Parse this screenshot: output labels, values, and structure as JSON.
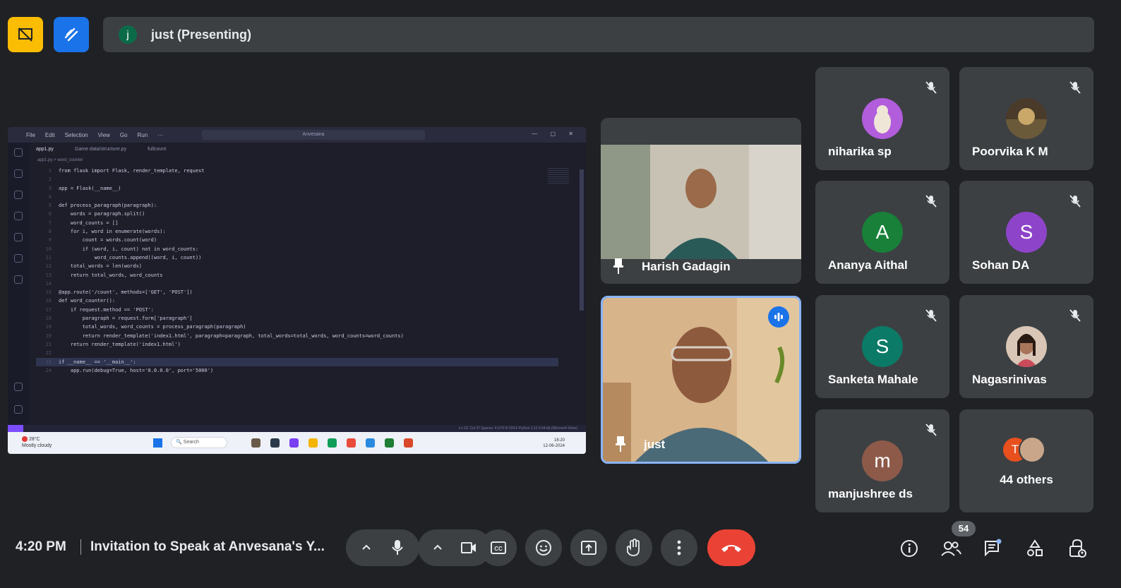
{
  "top_bar": {
    "presenter_initial": "j",
    "presenter_label": "just (Presenting)"
  },
  "shared_screen": {
    "menu": [
      "File",
      "Edit",
      "Selection",
      "View",
      "Go",
      "Run",
      "···"
    ],
    "search": "Anvesana",
    "tabs": [
      "app1.py",
      "Game data/structure.py",
      "fullcount"
    ],
    "breadcrumb": "app1.py > word_counter",
    "code_lines": [
      {
        "n": "1",
        "text": "from flask import Flask, render_template, request"
      },
      {
        "n": "2",
        "text": ""
      },
      {
        "n": "3",
        "text": "app = Flask(__name__)"
      },
      {
        "n": "4",
        "text": ""
      },
      {
        "n": "5",
        "text": "def process_paragraph(paragraph):"
      },
      {
        "n": "6",
        "text": "    words = paragraph.split()"
      },
      {
        "n": "7",
        "text": "    word_counts = []"
      },
      {
        "n": "8",
        "text": "    for i, word in enumerate(words):"
      },
      {
        "n": "9",
        "text": "        count = words.count(word)"
      },
      {
        "n": "10",
        "text": "        if (word, i, count) not in word_counts:"
      },
      {
        "n": "11",
        "text": "            word_counts.append((word, i, count))"
      },
      {
        "n": "12",
        "text": "    total_words = len(words)"
      },
      {
        "n": "13",
        "text": "    return total_words, word_counts"
      },
      {
        "n": "14",
        "text": ""
      },
      {
        "n": "15",
        "text": "@app.route('/count', methods=['GET', 'POST'])"
      },
      {
        "n": "16",
        "text": "def word_counter():"
      },
      {
        "n": "17",
        "text": "    if request.method == 'POST':"
      },
      {
        "n": "18",
        "text": "        paragraph = request.form['paragraph']"
      },
      {
        "n": "19",
        "text": "        total_words, word_counts = process_paragraph(paragraph)"
      },
      {
        "n": "20",
        "text": "        return render_template('index1.html', paragraph=paragraph, total_words=total_words, word_counts=word_counts)"
      },
      {
        "n": "21",
        "text": "    return render_template('index1.html')"
      },
      {
        "n": "22",
        "text": ""
      },
      {
        "n": "23",
        "text": "if __name__ == '__main__':"
      },
      {
        "n": "24",
        "text": "    app.run(debug=True, host='0.0.0.0', port='5000')"
      }
    ],
    "status_right": "Ln 23, Col 27   Spaces: 4   UTF-8   CRLF   Python   3.12.4 64-bit (Microsoft Store)",
    "taskbar_weather_temp": "28°C",
    "taskbar_weather_desc": "Mostly cloudy",
    "taskbar_search": "Search",
    "taskbar_time": "16:20",
    "taskbar_date": "12-06-2024"
  },
  "video_tiles": [
    {
      "name": "Harish Gadagin"
    },
    {
      "name": "just"
    }
  ],
  "participants": [
    {
      "name": "niharika sp",
      "initial": "",
      "color": "#b15ddc"
    },
    {
      "name": "Poorvika K M",
      "initial": "",
      "color": "#4a3a2a"
    },
    {
      "name": "Ananya Aithal",
      "initial": "A",
      "color": "#188038"
    },
    {
      "name": "Sohan DA",
      "initial": "S",
      "color": "#8e44c9"
    },
    {
      "name": "Sanketa Mahale",
      "initial": "S",
      "color": "#0b7a66"
    },
    {
      "name": "Nagasrinivas",
      "initial": "",
      "color": "#d9c6b6"
    },
    {
      "name": "manjushree ds",
      "initial": "m",
      "color": "#8d5a4a"
    }
  ],
  "others": {
    "initial": "T",
    "label": "44 others"
  },
  "bottom_bar": {
    "time": "4:20 PM",
    "meeting_title": "Invitation to Speak at Anvesana's Y...",
    "participant_count": "54"
  },
  "colors": {
    "background": "#202124",
    "tile": "#3c4043",
    "end_call": "#ea4335",
    "active_border": "#8ab4f8"
  }
}
